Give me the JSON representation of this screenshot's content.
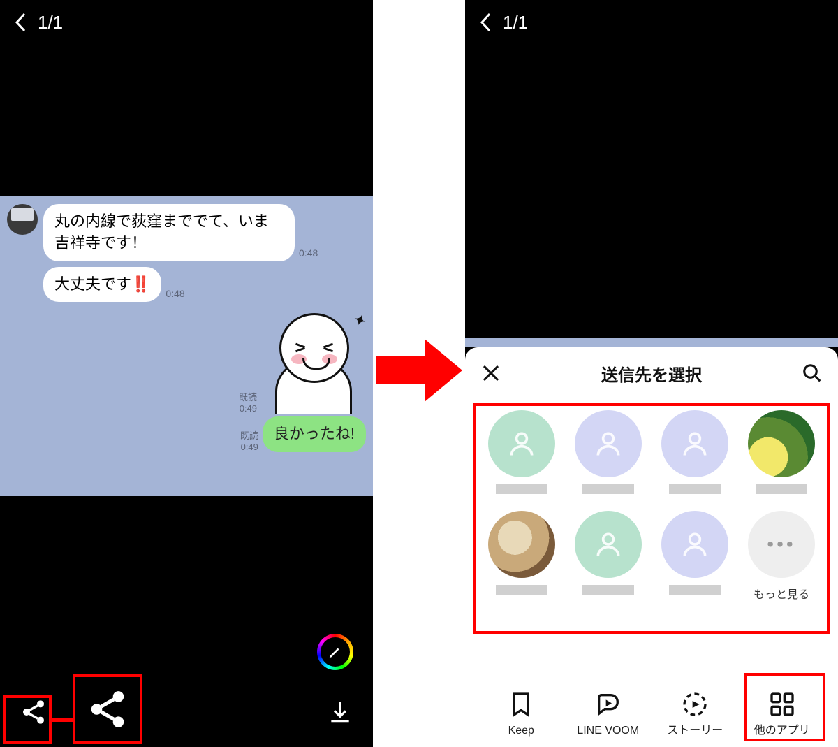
{
  "left": {
    "counter": "1/1",
    "chat": {
      "msg1": "丸の内線で荻窪まででて、いま吉祥寺です！",
      "msg1_time": "0:48",
      "msg2_pre": "大丈夫です",
      "msg2_emoji": "‼️",
      "msg2_time": "0:48",
      "read_label_1": "既読",
      "sticker_time": "0:49",
      "read_label_2": "既読",
      "reply_time": "0:49",
      "reply": "良かったね!"
    }
  },
  "right": {
    "counter": "1/1",
    "sheet": {
      "title": "送信先を選択",
      "more_label": "もっと見る",
      "contacts": [
        {
          "style": "green",
          "type": "silhouette"
        },
        {
          "style": "lav",
          "type": "silhouette"
        },
        {
          "style": "lav",
          "type": "silhouette"
        },
        {
          "style": "photo1",
          "type": "photo"
        },
        {
          "style": "photo2",
          "type": "photo"
        },
        {
          "style": "green",
          "type": "silhouette"
        },
        {
          "style": "lav",
          "type": "silhouette"
        },
        {
          "style": "gray",
          "type": "more"
        }
      ],
      "share": {
        "keep": "Keep",
        "voom": "LINE VOOM",
        "story": "ストーリー",
        "other": "他のアプリ"
      }
    }
  },
  "colors": {
    "highlight": "#ff0000"
  }
}
